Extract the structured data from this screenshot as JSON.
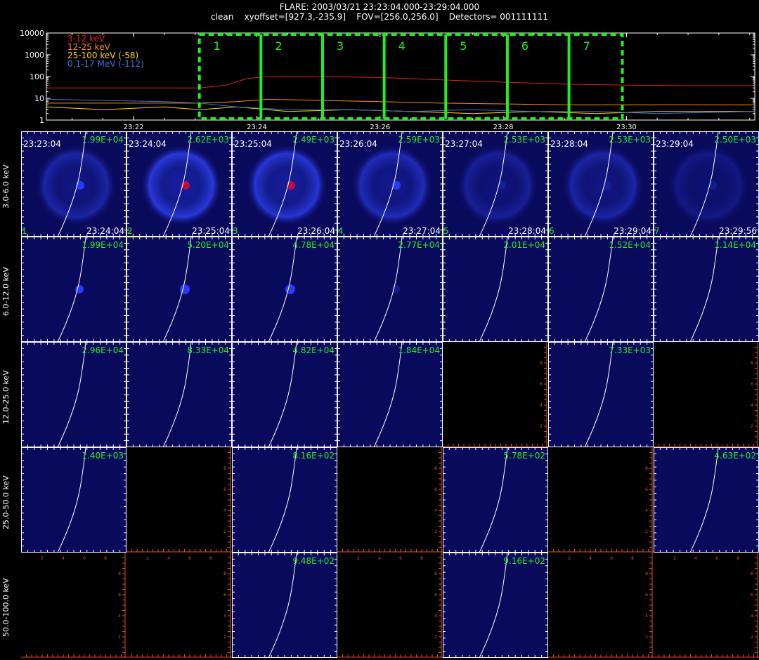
{
  "header": {
    "line1": "FLARE: 2003/03/21 23:23:04.000-23:29:04.000",
    "line2": "clean    xyoffset=[927.3,-235.9]    FOV=[256.0,256.0]    Detectors= 001111111"
  },
  "colors": {
    "band1": "#e02020",
    "band2": "#ff8c00",
    "band3": "#ffd700",
    "band4": "#3a6fe0",
    "interval_box": "#22ee22",
    "value_label": "#22ee22",
    "empty_axis": "#e05020",
    "image_bg": "#0a0a5c",
    "source": "#2030ff"
  },
  "chart_data": [
    {
      "type": "line",
      "title": "",
      "yscale": "log",
      "ylim": [
        1,
        10000
      ],
      "y_ticks": [
        "10000",
        "1000",
        "100",
        "10",
        "1"
      ],
      "x_ticks": [
        "23:22",
        "23:24",
        "23:26",
        "23:28",
        "23:30"
      ],
      "x_range": [
        "23:20:35",
        "23:32:05"
      ],
      "legend_placement": "top-left",
      "series": [
        {
          "name": "3-12 keV",
          "color": "#e02020",
          "x": [
            "23:20:35",
            "23:22:00",
            "23:23:04",
            "23:23:30",
            "23:23:50",
            "23:24:10",
            "23:25:00",
            "23:26:00",
            "23:27:00",
            "23:28:00",
            "23:29:00",
            "23:30:00",
            "23:31:00",
            "23:32:05"
          ],
          "y": [
            30,
            30,
            30,
            40,
            80,
            100,
            100,
            90,
            70,
            55,
            45,
            40,
            38,
            38
          ]
        },
        {
          "name": "12-25 keV",
          "color": "#ff8c00",
          "x": [
            "23:20:35",
            "23:22:00",
            "23:23:04",
            "23:23:40",
            "23:24:10",
            "23:25:00",
            "23:26:00",
            "23:27:00",
            "23:28:00",
            "23:29:00",
            "23:30:00",
            "23:32:05"
          ],
          "y": [
            6,
            6,
            6,
            7,
            9,
            8,
            7,
            6,
            5.5,
            5,
            5,
            5
          ]
        },
        {
          "name": "25-100 keV (-58)",
          "color": "#ffd700",
          "x": [
            "23:20:35",
            "23:21:30",
            "23:22:30",
            "23:23:04",
            "23:23:40",
            "23:24:30",
            "23:25:30",
            "23:26:30",
            "23:27:30",
            "23:28:30",
            "23:29:30",
            "23:30:30",
            "23:32:05"
          ],
          "y": [
            4,
            3,
            4,
            3,
            4,
            2.5,
            3,
            2.5,
            2,
            2.5,
            2,
            2.5,
            2.5
          ]
        },
        {
          "name": "0.1-17 MeV (-112)",
          "color": "#3a6fe0",
          "x": [
            "23:20:35",
            "23:21:30",
            "23:22:30",
            "23:23:04",
            "23:23:40",
            "23:24:30",
            "23:25:30",
            "23:26:30",
            "23:27:30",
            "23:28:30",
            "23:29:30",
            "23:30:30",
            "23:32:05"
          ],
          "y": [
            9,
            8,
            7,
            6,
            4,
            3,
            3,
            2.5,
            3,
            2.5,
            2.5,
            2,
            2.5
          ]
        }
      ],
      "intervals": [
        "1",
        "2",
        "3",
        "4",
        "5",
        "6",
        "7"
      ],
      "interval_edges": [
        "23:23:04",
        "23:24:04",
        "23:25:04",
        "23:26:04",
        "23:27:04",
        "23:28:04",
        "23:29:04",
        "23:29:56"
      ]
    },
    {
      "type": "heatmap",
      "row_labels": [
        "3.0-6.0 keV",
        "6.0-12.0 keV",
        "12.0-25.0 keV",
        "25.0-50.0 keV",
        "50.0-100.0 keV"
      ],
      "columns": [
        {
          "index": "1",
          "start": "23:23:04",
          "end": "23:24:04"
        },
        {
          "index": "2",
          "start": "23:24:04",
          "end": "23:25:04"
        },
        {
          "index": "3",
          "start": "23:25:04",
          "end": "23:26:04"
        },
        {
          "index": "4",
          "start": "23:26:04",
          "end": "23:27:04"
        },
        {
          "index": "5",
          "start": "23:27:04",
          "end": "23:28:04"
        },
        {
          "index": "6",
          "start": "23:28:04",
          "end": "23:29:04"
        },
        {
          "index": "7",
          "start": "23:29:04",
          "end": "23:29:56"
        }
      ],
      "cells": [
        [
          {
            "value": "1.99E+04",
            "intensity": 0.55,
            "ring": true,
            "spot": "blue"
          },
          {
            "value": "2.62E+03",
            "intensity": 0.95,
            "ring": true,
            "spot": "red"
          },
          {
            "value": "2.49E+03",
            "intensity": 0.9,
            "ring": true,
            "spot": "red"
          },
          {
            "value": "2.59E+03",
            "intensity": 0.7,
            "ring": true,
            "spot": "blue"
          },
          {
            "value": "2.53E+03",
            "intensity": 0.45,
            "ring": true,
            "spot": "dim"
          },
          {
            "value": "2.53E+03",
            "intensity": 0.55,
            "ring": true,
            "spot": "dim"
          },
          {
            "value": "2.50E+03",
            "intensity": 0.3,
            "ring": true,
            "spot": "dim"
          }
        ],
        [
          {
            "value": "1.99E+04",
            "intensity": 0.1,
            "ring": false,
            "spot": "blue"
          },
          {
            "value": "5.20E+04",
            "intensity": 0.1,
            "ring": false,
            "spot": "bright"
          },
          {
            "value": "4.78E+04",
            "intensity": 0.1,
            "ring": false,
            "spot": "bright"
          },
          {
            "value": "2.77E+04",
            "intensity": 0.05,
            "ring": false,
            "spot": "dim"
          },
          {
            "value": "2.01E+04",
            "intensity": 0,
            "ring": false,
            "spot": "none"
          },
          {
            "value": "1.52E+04",
            "intensity": 0,
            "ring": false,
            "spot": "none"
          },
          {
            "value": "1.14E+04",
            "intensity": 0,
            "ring": false,
            "spot": "none"
          }
        ],
        [
          {
            "value": "2.96E+04",
            "intensity": 0,
            "ring": false,
            "spot": "none"
          },
          {
            "value": "8.33E+04",
            "intensity": 0,
            "ring": false,
            "spot": "none"
          },
          {
            "value": "4.82E+04",
            "intensity": 0,
            "ring": false,
            "spot": "none"
          },
          {
            "value": "1.84E+04",
            "intensity": 0,
            "ring": false,
            "spot": "none"
          },
          null,
          {
            "value": "7.33E+03",
            "intensity": 0,
            "ring": false,
            "spot": "none"
          },
          null
        ],
        [
          {
            "value": "1.40E+03",
            "intensity": 0,
            "ring": false,
            "spot": "none"
          },
          null,
          {
            "value": "8.16E+02",
            "intensity": 0,
            "ring": false,
            "spot": "none"
          },
          null,
          {
            "value": "5.78E+02",
            "intensity": 0,
            "ring": false,
            "spot": "none"
          },
          null,
          {
            "value": "4.63E+02",
            "intensity": 0,
            "ring": false,
            "spot": "none"
          }
        ],
        [
          null,
          null,
          {
            "value": "9.48E+02",
            "intensity": 0,
            "ring": false,
            "spot": "none"
          },
          null,
          {
            "value": "9.16E+02",
            "intensity": 0,
            "ring": false,
            "spot": "none"
          },
          null,
          null
        ]
      ],
      "empty_axis_ticks": [
        "0",
        "2",
        "4",
        "6",
        "8"
      ]
    }
  ]
}
